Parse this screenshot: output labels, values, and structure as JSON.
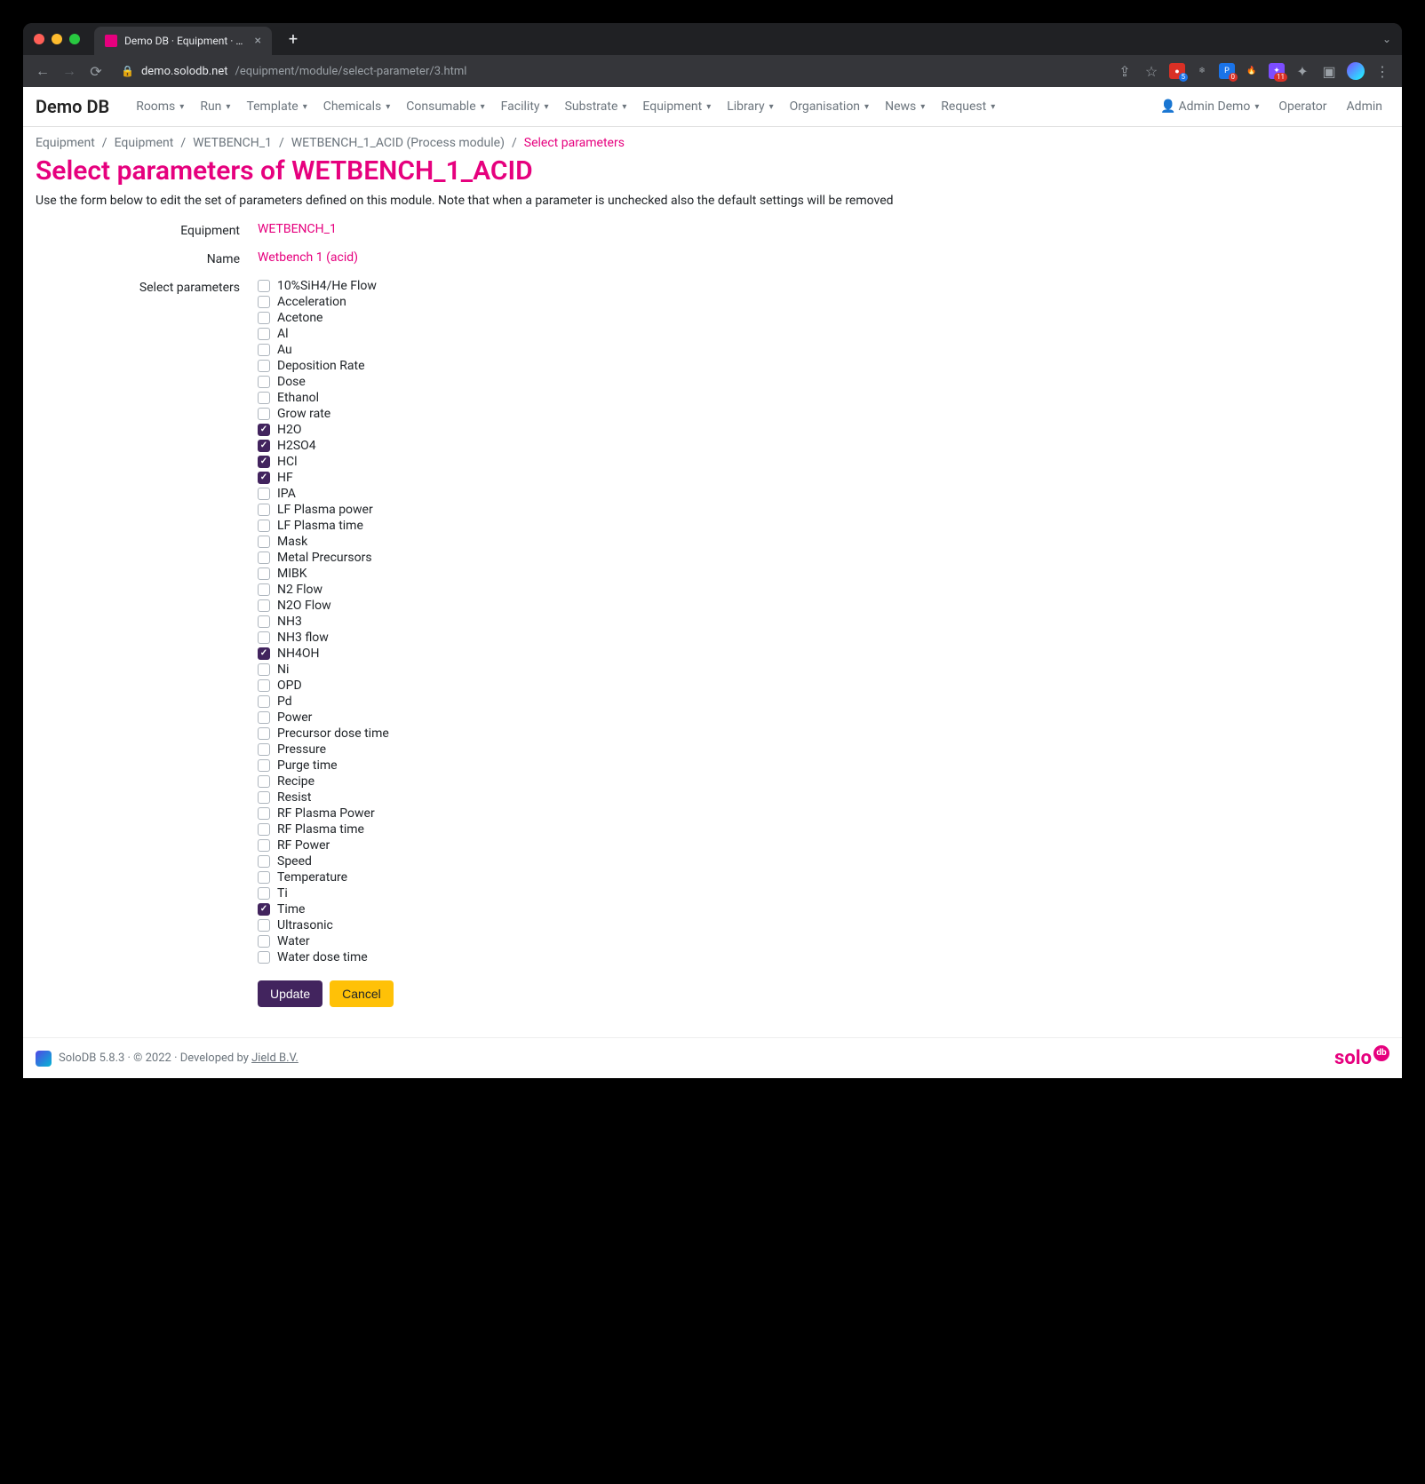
{
  "browser": {
    "tab_title": "Demo DB · Equipment · Select…",
    "url_host": "demo.solodb.net",
    "url_path": "/equipment/module/select-parameter/3.html",
    "ext_badge_5": "5",
    "ext_badge_0": "0",
    "ext_badge_11": "11"
  },
  "nav": {
    "brand": "Demo DB",
    "items": [
      "Rooms",
      "Run",
      "Template",
      "Chemicals",
      "Consumable",
      "Facility",
      "Substrate",
      "Equipment",
      "Library",
      "Organisation",
      "News",
      "Request"
    ],
    "right": {
      "admin_demo": "Admin Demo",
      "operator": "Operator",
      "admin": "Admin"
    }
  },
  "breadcrumb": [
    {
      "label": "Equipment",
      "link": true
    },
    {
      "label": "Equipment",
      "link": true
    },
    {
      "label": "WETBENCH_1",
      "link": true
    },
    {
      "label": "WETBENCH_1_ACID (Process module)",
      "link": true
    },
    {
      "label": "Select parameters",
      "current": true
    }
  ],
  "page_title": "Select parameters of WETBENCH_1_ACID",
  "description": "Use the form below to edit the set of parameters defined on this module. Note that when a parameter is unchecked also the default settings will be removed",
  "form": {
    "equipment_label": "Equipment",
    "equipment_value": "WETBENCH_1",
    "name_label": "Name",
    "name_value": "Wetbench 1 (acid)",
    "params_label": "Select parameters",
    "params": [
      {
        "label": "10%SiH4/He Flow",
        "checked": false
      },
      {
        "label": "Acceleration",
        "checked": false
      },
      {
        "label": "Acetone",
        "checked": false
      },
      {
        "label": "Al",
        "checked": false
      },
      {
        "label": "Au",
        "checked": false
      },
      {
        "label": "Deposition Rate",
        "checked": false
      },
      {
        "label": "Dose",
        "checked": false
      },
      {
        "label": "Ethanol",
        "checked": false
      },
      {
        "label": "Grow rate",
        "checked": false
      },
      {
        "label": "H2O",
        "checked": true
      },
      {
        "label": "H2SO4",
        "checked": true
      },
      {
        "label": "HCl",
        "checked": true
      },
      {
        "label": "HF",
        "checked": true
      },
      {
        "label": "IPA",
        "checked": false
      },
      {
        "label": "LF Plasma power",
        "checked": false
      },
      {
        "label": "LF Plasma time",
        "checked": false
      },
      {
        "label": "Mask",
        "checked": false
      },
      {
        "label": "Metal Precursors",
        "checked": false
      },
      {
        "label": "MIBK",
        "checked": false
      },
      {
        "label": "N2 Flow",
        "checked": false
      },
      {
        "label": "N2O Flow",
        "checked": false
      },
      {
        "label": "NH3",
        "checked": false
      },
      {
        "label": "NH3 flow",
        "checked": false
      },
      {
        "label": "NH4OH",
        "checked": true
      },
      {
        "label": "Ni",
        "checked": false
      },
      {
        "label": "OPD",
        "checked": false
      },
      {
        "label": "Pd",
        "checked": false
      },
      {
        "label": "Power",
        "checked": false
      },
      {
        "label": "Precursor dose time",
        "checked": false
      },
      {
        "label": "Pressure",
        "checked": false
      },
      {
        "label": "Purge time",
        "checked": false
      },
      {
        "label": "Recipe",
        "checked": false
      },
      {
        "label": "Resist",
        "checked": false
      },
      {
        "label": "RF Plasma Power",
        "checked": false
      },
      {
        "label": "RF Plasma time",
        "checked": false
      },
      {
        "label": "RF Power",
        "checked": false
      },
      {
        "label": "Speed",
        "checked": false
      },
      {
        "label": "Temperature",
        "checked": false
      },
      {
        "label": "Ti",
        "checked": false
      },
      {
        "label": "Time",
        "checked": true
      },
      {
        "label": "Ultrasonic",
        "checked": false
      },
      {
        "label": "Water",
        "checked": false
      },
      {
        "label": "Water dose time",
        "checked": false
      }
    ],
    "update_btn": "Update",
    "cancel_btn": "Cancel"
  },
  "footer": {
    "version": "SoloDB 5.8.3 · © 2022 · Developed by ",
    "vendor": "Jield B.V.",
    "logo_text": "solo",
    "logo_db": "db"
  }
}
